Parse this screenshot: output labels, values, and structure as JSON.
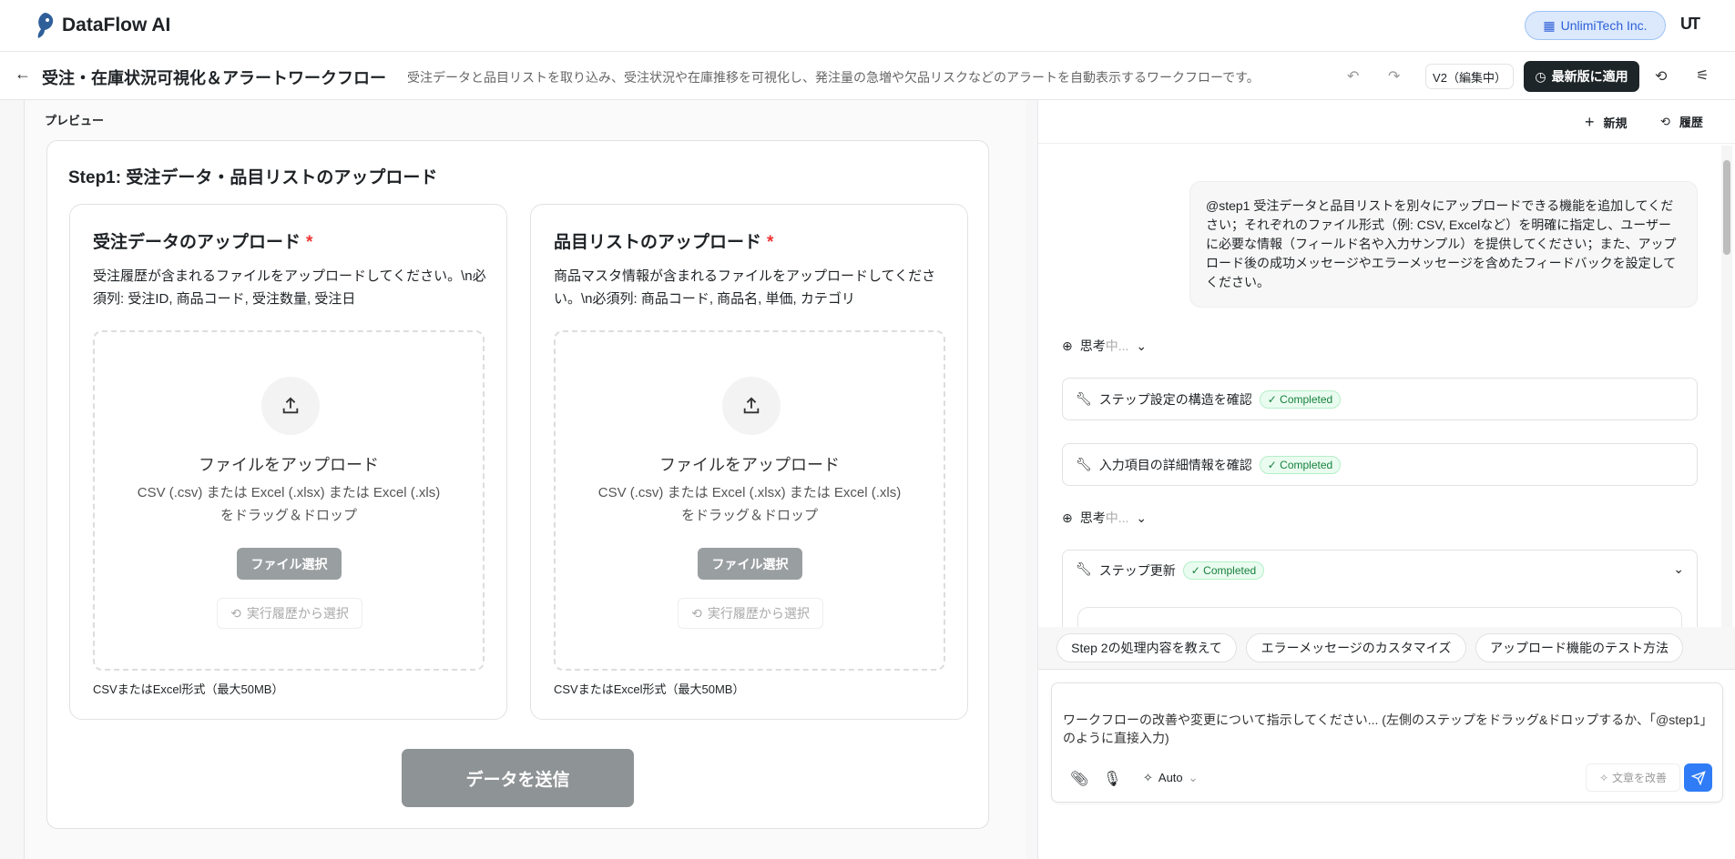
{
  "app": {
    "name": "DataFlow AI",
    "org": "UnlimiTech Inc.",
    "user_initials": "UT"
  },
  "toolbar": {
    "title": "受注・在庫状況可視化＆アラートワークフロー",
    "description": "受注データと品目リストを取り込み、受注状況や在庫推移を可視化し、発注量の急増や欠品リスクなどのアラートを自動表示するワークフローです。",
    "version": "V2（編集中）",
    "apply": "最新版に適用"
  },
  "preview": {
    "label": "プレビュー",
    "step_title": "Step1: 受注データ・品目リストのアップロード",
    "cards": [
      {
        "title": "受注データのアップロード",
        "required": "*",
        "desc": "受注履歴が含まれるファイルをアップロードしてください。\\n必須列: 受注ID, 商品コード, 受注数量, 受注日",
        "drop_title": "ファイルをアップロード",
        "drop_desc": "CSV (.csv) または Excel (.xlsx) または Excel (.xls)をドラッグ＆ドロップ",
        "select": "ファイル選択",
        "history": "実行履歴から選択",
        "foot": "CSVまたはExcel形式（最大50MB）"
      },
      {
        "title": "品目リストのアップロード",
        "required": "*",
        "desc": "商品マスタ情報が含まれるファイルをアップロードしてください。\\n必須列: 商品コード, 商品名, 単価, カテゴリ",
        "drop_title": "ファイルをアップロード",
        "drop_desc": "CSV (.csv) または Excel (.xlsx) または Excel (.xls)をドラッグ＆ドロップ",
        "select": "ファイル選択",
        "history": "実行履歴から選択",
        "foot": "CSVまたはExcel形式（最大50MB）"
      }
    ],
    "submit": "データを送信"
  },
  "chat": {
    "new": "新規",
    "history": "履歴",
    "user_message": "@step1 受注データと品目リストを別々にアップロードできる機能を追加してください；それぞれのファイル形式（例: CSV, Excelなど）を明確に指定し、ユーザーに必要な情報（フィールド名や入力サンプル）を提供してください；また、アップロード後の成功メッセージやエラーメッセージを含めたフィードバックを設定してください。",
    "thinking_a": "思考",
    "thinking_b": "中...",
    "tools": [
      {
        "name": "ステップ設定の構造を確認",
        "status": "Completed"
      },
      {
        "name": "入力項目の詳細情報を確認",
        "status": "Completed"
      },
      {
        "name": "ステップ更新",
        "status": "Completed"
      }
    ],
    "suggestions": [
      "Step 2の処理内容を教えて",
      "エラーメッセージのカスタマイズ",
      "アップロード機能のテスト方法"
    ],
    "placeholder": "ワークフローの改善や変更について指示してください... (左側のステップをドラッグ&ドロップするか、「@step1」のように直接入力)",
    "mode": "Auto",
    "improve": "文章を改善"
  }
}
